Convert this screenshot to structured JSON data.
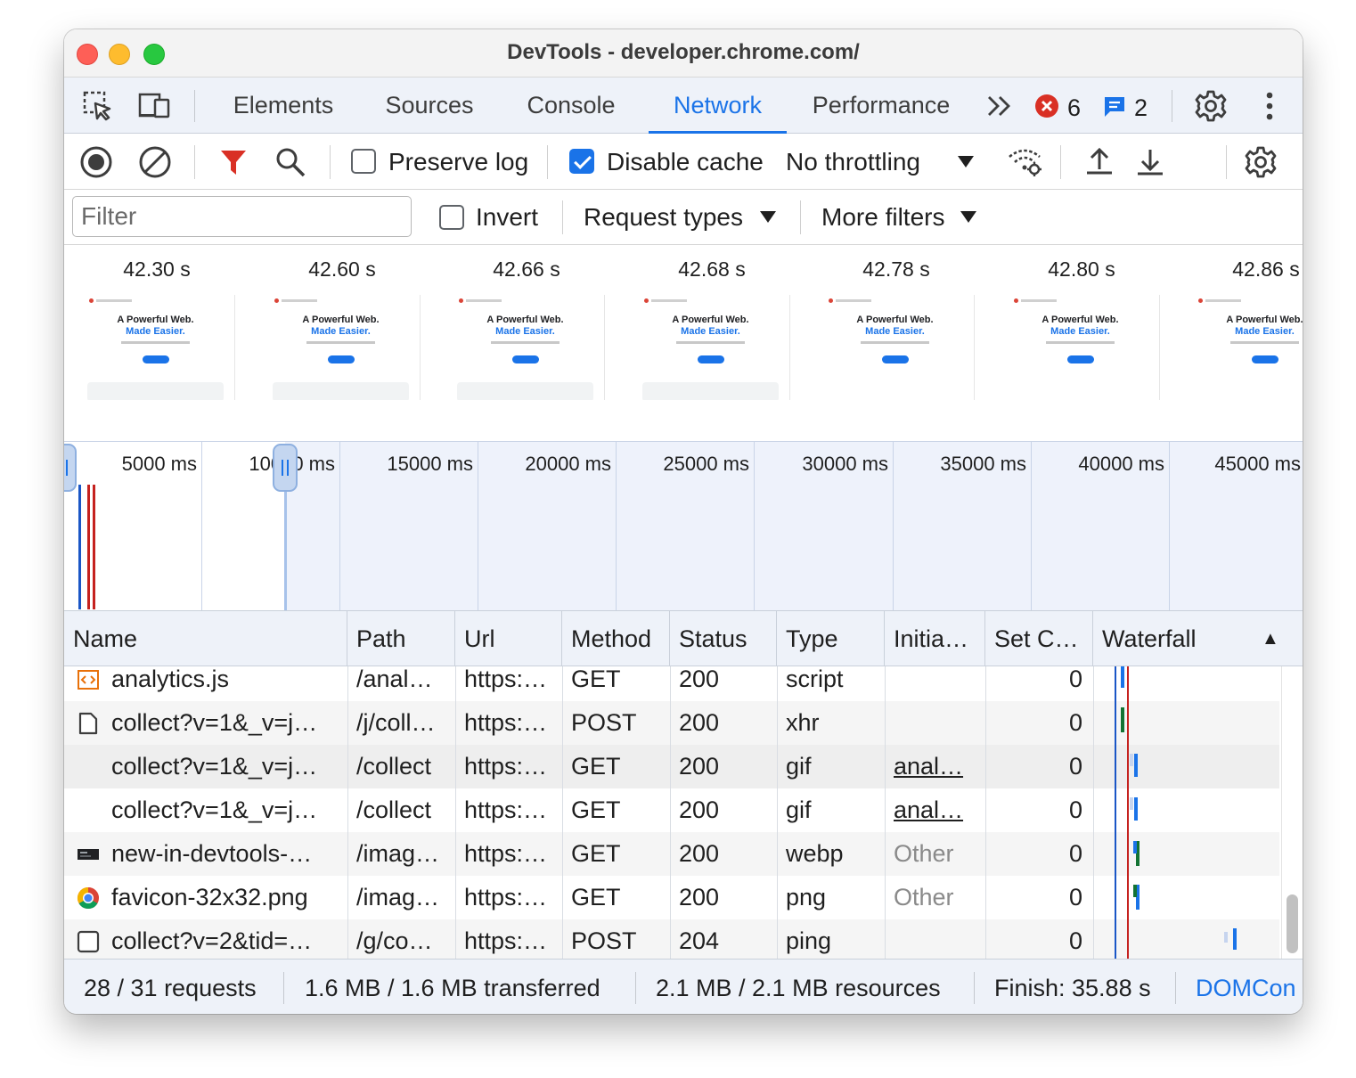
{
  "window": {
    "title": "DevTools - developer.chrome.com/"
  },
  "tabs": [
    {
      "label": "Elements"
    },
    {
      "label": "Sources"
    },
    {
      "label": "Console"
    },
    {
      "label": "Network",
      "active": true
    },
    {
      "label": "Performance"
    }
  ],
  "badges": {
    "errors": "6",
    "messages": "2"
  },
  "toolbar": {
    "preserve_log_label": "Preserve log",
    "preserve_log_checked": false,
    "disable_cache_label": "Disable cache",
    "disable_cache_checked": true,
    "throttling_value": "No throttling"
  },
  "filterbar": {
    "filter_placeholder": "Filter",
    "filter_value": "",
    "invert_label": "Invert",
    "request_types_label": "Request types",
    "more_filters_label": "More filters"
  },
  "screenshots": {
    "headline": "A Powerful Web.",
    "headline_accent": "Made Easier.",
    "frames": [
      {
        "time": "42.30 s"
      },
      {
        "time": "42.60 s"
      },
      {
        "time": "42.66 s"
      },
      {
        "time": "42.68 s"
      },
      {
        "time": "42.78 s"
      },
      {
        "time": "42.80 s"
      },
      {
        "time": "42.86 s"
      }
    ]
  },
  "overview": {
    "ticks": [
      "5000 ms",
      "10000 ms",
      "15000 ms",
      "20000 ms",
      "25000 ms",
      "30000 ms",
      "35000 ms",
      "40000 ms",
      "45000 ms"
    ]
  },
  "table": {
    "columns": [
      "Name",
      "Path",
      "Url",
      "Method",
      "Status",
      "Type",
      "Initia…",
      "Set C…",
      "Waterfall"
    ],
    "sort_indicator": "▲",
    "rows": [
      {
        "icon": "script-icon",
        "name": "analytics.js",
        "path": "/anal…",
        "url": "https:…",
        "method": "GET",
        "status": "200",
        "type": "script",
        "initiator": "",
        "set_cookies": "0"
      },
      {
        "icon": "document-icon",
        "name": "collect?v=1&_v=j…",
        "path": "/j/coll…",
        "url": "https:…",
        "method": "POST",
        "status": "200",
        "type": "xhr",
        "initiator": "",
        "set_cookies": "0"
      },
      {
        "icon": "",
        "name": "collect?v=1&_v=j…",
        "path": "/collect",
        "url": "https:…",
        "method": "GET",
        "status": "200",
        "type": "gif",
        "initiator": "anal…",
        "set_cookies": "0"
      },
      {
        "icon": "",
        "name": "collect?v=1&_v=j…",
        "path": "/collect",
        "url": "https:…",
        "method": "GET",
        "status": "200",
        "type": "gif",
        "initiator": "anal…",
        "set_cookies": "0"
      },
      {
        "icon": "image-thumb-icon",
        "name": "new-in-devtools-…",
        "path": "/imag…",
        "url": "https:…",
        "method": "GET",
        "status": "200",
        "type": "webp",
        "initiator": "Other",
        "set_cookies": "0"
      },
      {
        "icon": "chrome-favicon-icon",
        "name": "favicon-32x32.png",
        "path": "/imag…",
        "url": "https:…",
        "method": "GET",
        "status": "200",
        "type": "png",
        "initiator": "Other",
        "set_cookies": "0"
      },
      {
        "icon": "checkbox-icon",
        "name": "collect?v=2&tid=…",
        "path": "/g/co…",
        "url": "https:…",
        "method": "POST",
        "status": "204",
        "type": "ping",
        "initiator": "",
        "set_cookies": "0"
      }
    ]
  },
  "statusbar": {
    "requests": "28 / 31 requests",
    "transferred": "1.6 MB / 1.6 MB transferred",
    "resources": "2.1 MB / 2.1 MB resources",
    "finish": "Finish: 35.88 s",
    "domcontentloaded": "DOMCon"
  },
  "colors": {
    "accent": "#1a73e8",
    "error": "#d93025",
    "dom_content_loaded_line": "#1a56c6",
    "load_line": "#c5221f"
  }
}
